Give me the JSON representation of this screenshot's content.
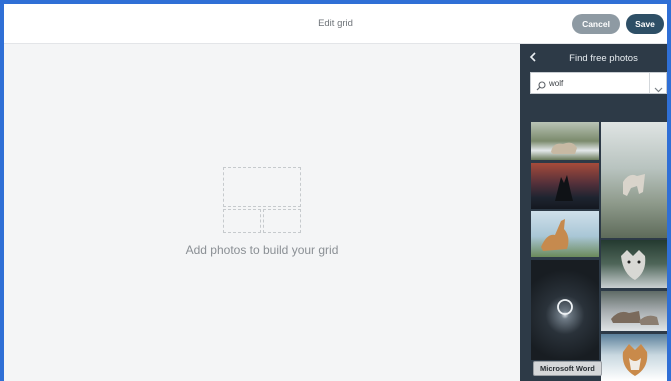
{
  "header": {
    "title": "Edit grid",
    "cancel_label": "Cancel",
    "save_label": "Save"
  },
  "canvas": {
    "empty_message": "Add photos to build your grid"
  },
  "panel": {
    "back_icon": "chevron-left-icon",
    "title": "Find free photos",
    "search": {
      "value": "wolf",
      "icon": "search-icon",
      "dropdown_icon": "chevron-down-icon"
    },
    "results": [
      {
        "name": "photo-result-1"
      },
      {
        "name": "photo-result-2"
      },
      {
        "name": "photo-result-3"
      },
      {
        "name": "photo-result-4"
      },
      {
        "name": "photo-result-5"
      },
      {
        "name": "photo-result-6"
      },
      {
        "name": "photo-result-7"
      },
      {
        "name": "photo-result-8"
      }
    ]
  },
  "tooltip": {
    "text": "Microsoft Word"
  },
  "colors": {
    "save_button": "#2e4f66",
    "cancel_button": "#8e9aa3",
    "panel_background": "#2d3a47",
    "window_border": "#2f6fd6"
  }
}
